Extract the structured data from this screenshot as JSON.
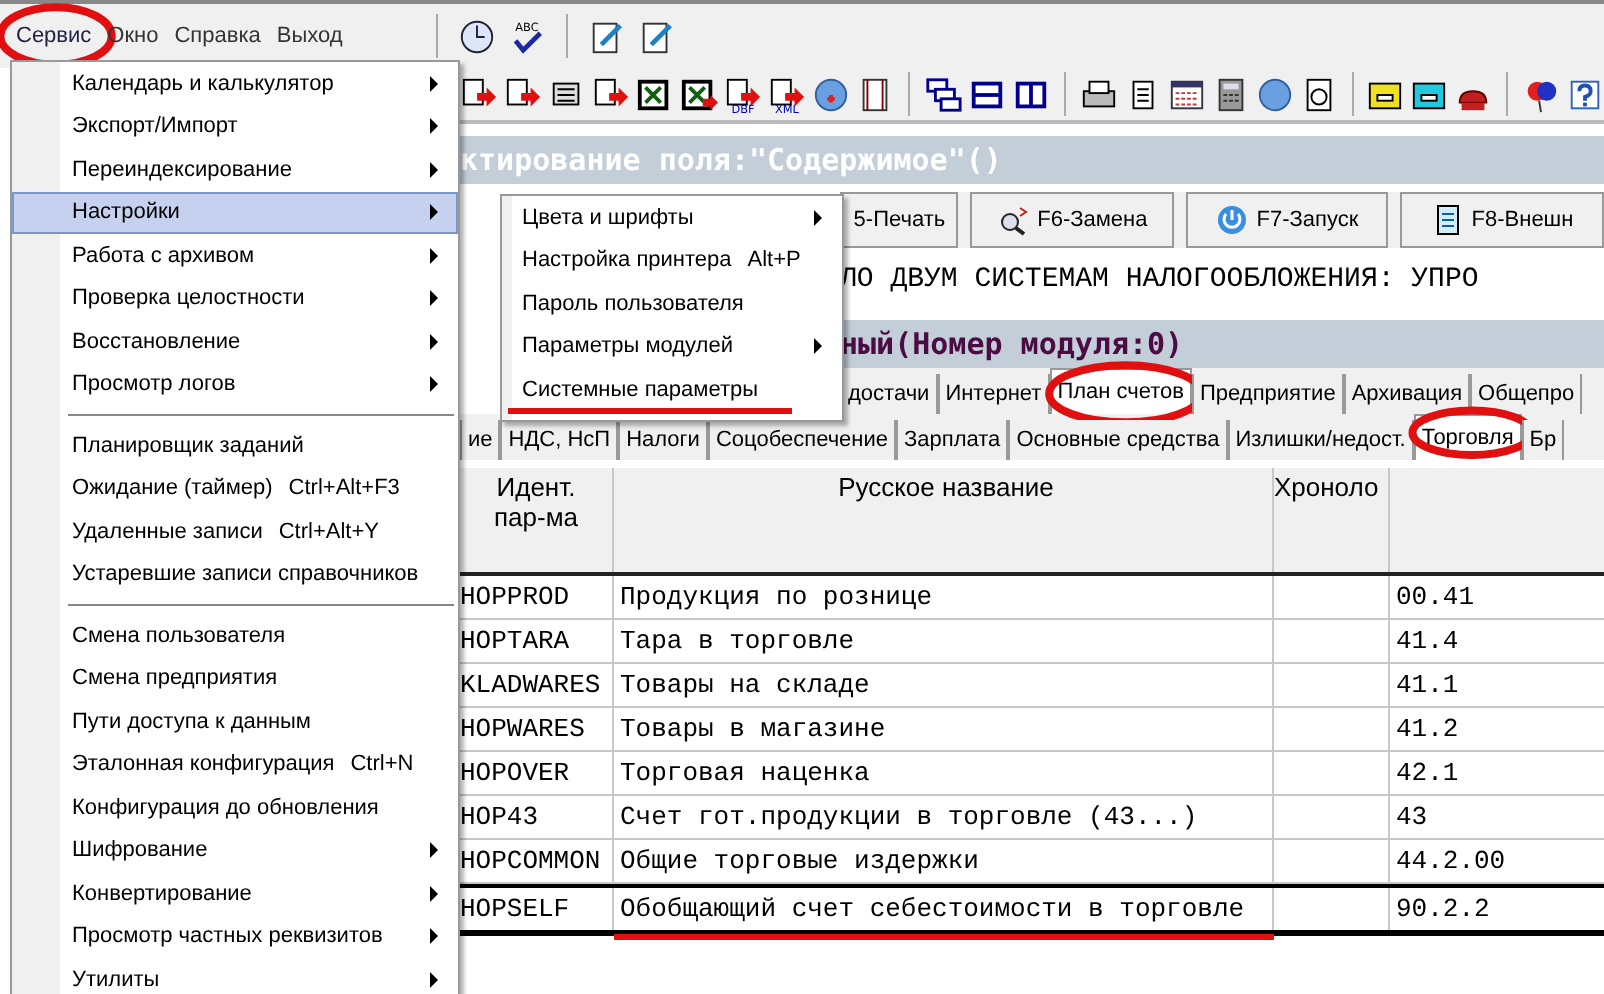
{
  "menubar": {
    "items": [
      {
        "label": "Сервис",
        "selected": true,
        "circled": true
      },
      {
        "label": "Окно",
        "selected": false,
        "circled": false
      },
      {
        "label": "Справка",
        "selected": false,
        "circled": false
      },
      {
        "label": "Выход",
        "selected": false,
        "circled": false
      }
    ],
    "spellcheck_label": "ABC"
  },
  "toolbar": {
    "labels": [
      "DBF",
      "XML"
    ]
  },
  "editor_title": "ктирование поля:\"Содержимое\"()",
  "function_buttons": [
    "5-Печать",
    "F6-Замена",
    "F7-Запуск",
    "F8-Внешн"
  ],
  "text_line": "ЛО ДВУМ СИСТЕМАМ НАЛОГООБЛОЖЕНИЯ: УПРО",
  "module_title": "ный(Номер модуля:0)",
  "tabs_top": [
    {
      "label": "достачи",
      "selected": false,
      "circled": false
    },
    {
      "label": "Интернет",
      "selected": false,
      "circled": false
    },
    {
      "label": "План счетов",
      "selected": true,
      "circled": true
    },
    {
      "label": "Предприятие",
      "selected": false,
      "circled": false
    },
    {
      "label": "Архивация",
      "selected": false,
      "circled": false
    },
    {
      "label": "Общепро",
      "selected": false,
      "circled": false
    }
  ],
  "tabs_bottom": [
    {
      "label": "ие",
      "selected": false,
      "circled": false
    },
    {
      "label": "НДС, НсП",
      "selected": false,
      "circled": false
    },
    {
      "label": "Налоги",
      "selected": false,
      "circled": false
    },
    {
      "label": "Соцобеспечение",
      "selected": false,
      "circled": false
    },
    {
      "label": "Зарплата",
      "selected": false,
      "circled": false
    },
    {
      "label": "Основные средства",
      "selected": false,
      "circled": false
    },
    {
      "label": "Излишки/недост.",
      "selected": false,
      "circled": false
    },
    {
      "label": "Торговля",
      "selected": true,
      "circled": true
    },
    {
      "label": "Бр",
      "selected": false,
      "circled": false
    }
  ],
  "table": {
    "columns": [
      "Идент. пар-ма",
      "Русское название",
      "Хроноло"
    ],
    "rows": [
      {
        "id": "HOPPROD",
        "name": "Продукция по рознице",
        "value": "00.41",
        "selected": false,
        "underlined": false
      },
      {
        "id": "HOPTARA",
        "name": "Тара в торговле",
        "value": "41.4",
        "selected": false,
        "underlined": false
      },
      {
        "id": "KLADWARES",
        "name": "Товары на складе",
        "value": "41.1",
        "selected": false,
        "underlined": false
      },
      {
        "id": "HOPWARES",
        "name": "Товары в магазине",
        "value": "41.2",
        "selected": false,
        "underlined": false
      },
      {
        "id": "HOPOVER",
        "name": "Торговая наценка",
        "value": "42.1",
        "selected": false,
        "underlined": false
      },
      {
        "id": "HOP43",
        "name": "Счет гот.продукции в торговле (43...)",
        "value": "43",
        "selected": false,
        "underlined": false
      },
      {
        "id": "HOPCOMMON",
        "name": "Общие торговые издержки",
        "value": "44.2.00",
        "selected": false,
        "underlined": false
      },
      {
        "id": "HOPSELF",
        "name": "Обобщающий счет себестоимости в торговле",
        "value": "90.2.2",
        "selected": true,
        "underlined": true
      }
    ]
  },
  "menu": {
    "items": [
      {
        "kind": "item",
        "label": "Календарь и калькулятор",
        "submenu": true,
        "selected": false
      },
      {
        "kind": "item",
        "label": "Экспорт/Импорт",
        "submenu": true,
        "selected": false
      },
      {
        "kind": "item",
        "label": "Переиндексирование",
        "submenu": true,
        "selected": false
      },
      {
        "kind": "item",
        "label": "Настройки",
        "submenu": true,
        "selected": true
      },
      {
        "kind": "item",
        "label": "Работа с архивом",
        "submenu": true,
        "selected": false
      },
      {
        "kind": "item",
        "label": "Проверка целостности",
        "submenu": true,
        "selected": false
      },
      {
        "kind": "item",
        "label": "Восстановление",
        "submenu": true,
        "selected": false
      },
      {
        "kind": "item",
        "label": "Просмотр логов",
        "submenu": true,
        "selected": false
      },
      {
        "kind": "separator"
      },
      {
        "kind": "item",
        "label": "Планировщик заданий",
        "submenu": false,
        "selected": false
      },
      {
        "kind": "item",
        "label": "Ожидание (таймер)",
        "shortcut": "Ctrl+Alt+F3",
        "submenu": false,
        "selected": false
      },
      {
        "kind": "item",
        "label": "Удаленные записи",
        "shortcut": "Ctrl+Alt+Y",
        "submenu": false,
        "selected": false
      },
      {
        "kind": "item",
        "label": "Устаревшие записи справочников",
        "submenu": false,
        "selected": false
      },
      {
        "kind": "separator"
      },
      {
        "kind": "item",
        "label": "Смена пользователя",
        "submenu": false,
        "selected": false
      },
      {
        "kind": "item",
        "label": "Смена предприятия",
        "submenu": false,
        "selected": false
      },
      {
        "kind": "item",
        "label": "Пути доступа к данным",
        "submenu": false,
        "selected": false
      },
      {
        "kind": "item",
        "label": "Эталонная конфигурация",
        "shortcut": "Ctrl+N",
        "submenu": false,
        "selected": false
      },
      {
        "kind": "item",
        "label": "Конфигурация до обновления",
        "submenu": false,
        "selected": false
      },
      {
        "kind": "item",
        "label": "Шифрование",
        "submenu": true,
        "selected": false
      },
      {
        "kind": "item",
        "label": "Конвертирование",
        "submenu": true,
        "selected": false
      },
      {
        "kind": "item",
        "label": "Просмотр частных реквизитов",
        "submenu": true,
        "selected": false
      },
      {
        "kind": "item",
        "label": "Утилиты",
        "submenu": true,
        "selected": false
      }
    ]
  },
  "submenu": {
    "items": [
      {
        "label": "Цвета и шрифты",
        "submenu": true,
        "underlined": false
      },
      {
        "label": "Настройка принтера",
        "shortcut": "Alt+P",
        "submenu": false,
        "underlined": false
      },
      {
        "label": "Пароль пользователя",
        "submenu": false,
        "underlined": false
      },
      {
        "label": "Параметры модулей",
        "submenu": true,
        "underlined": false
      },
      {
        "label": "Системные параметры",
        "submenu": false,
        "underlined": true
      }
    ]
  }
}
